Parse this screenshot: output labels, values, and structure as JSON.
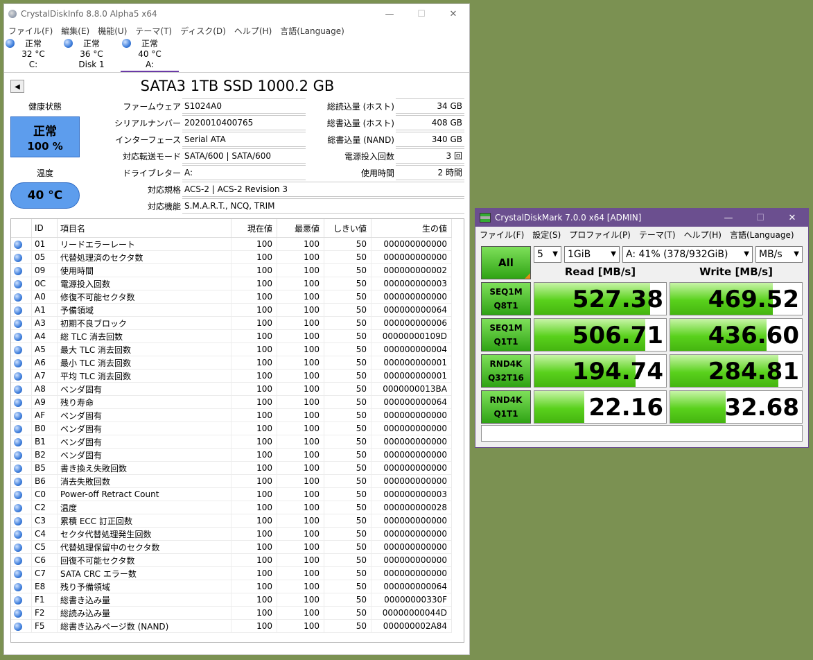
{
  "cdi": {
    "title": "CrystalDiskInfo 8.8.0 Alpha5 x64",
    "controls": [
      "—",
      "☐",
      "✕"
    ],
    "menu": [
      "ファイル(F)",
      "編集(E)",
      "機能(U)",
      "テーマ(T)",
      "ディスク(D)",
      "ヘルプ(H)",
      "言語(Language)"
    ],
    "tabs": [
      {
        "status": "正常",
        "temp": "32 °C",
        "name": "C:"
      },
      {
        "status": "正常",
        "temp": "36 °C",
        "name": "Disk 1"
      },
      {
        "status": "正常",
        "temp": "40 °C",
        "name": "A:"
      }
    ],
    "model": "SATA3 1TB SSD 1000.2 GB",
    "health_label": "健康状態",
    "health_status": "正常",
    "health_percent": "100 %",
    "temp_label": "温度",
    "temp_value": "40 °C",
    "left_fields": [
      {
        "label": "ファームウェア",
        "value": "S1024A0"
      },
      {
        "label": "シリアルナンバー",
        "value": "2020010400765"
      },
      {
        "label": "インターフェース",
        "value": "Serial ATA"
      },
      {
        "label": "対応転送モード",
        "value": "SATA/600 | SATA/600"
      },
      {
        "label": "ドライブレター",
        "value": "A:"
      }
    ],
    "right_fields": [
      {
        "label": "総読込量 (ホスト)",
        "value": "34 GB"
      },
      {
        "label": "総書込量 (ホスト)",
        "value": "408 GB"
      },
      {
        "label": "総書込量 (NAND)",
        "value": "340 GB"
      },
      {
        "label": "電源投入回数",
        "value": "3 回"
      },
      {
        "label": "使用時間",
        "value": "2 時間"
      }
    ],
    "wide_fields": [
      {
        "label": "対応規格",
        "value": "ACS-2 | ACS-2 Revision 3"
      },
      {
        "label": "対応機能",
        "value": "S.M.A.R.T., NCQ, TRIM"
      }
    ],
    "smart_headers": [
      "ID",
      "項目名",
      "現在値",
      "最悪値",
      "しきい値",
      "生の値"
    ],
    "smart_rows": [
      [
        "01",
        "リードエラーレート",
        "100",
        "100",
        "50",
        "000000000000"
      ],
      [
        "05",
        "代替処理済のセクタ数",
        "100",
        "100",
        "50",
        "000000000000"
      ],
      [
        "09",
        "使用時間",
        "100",
        "100",
        "50",
        "000000000002"
      ],
      [
        "0C",
        "電源投入回数",
        "100",
        "100",
        "50",
        "000000000003"
      ],
      [
        "A0",
        "修復不可能セクタ数",
        "100",
        "100",
        "50",
        "000000000000"
      ],
      [
        "A1",
        "予備領域",
        "100",
        "100",
        "50",
        "000000000064"
      ],
      [
        "A3",
        "初期不良ブロック",
        "100",
        "100",
        "50",
        "000000000006"
      ],
      [
        "A4",
        "総 TLC 消去回数",
        "100",
        "100",
        "50",
        "00000000109D"
      ],
      [
        "A5",
        "最大 TLC 消去回数",
        "100",
        "100",
        "50",
        "000000000004"
      ],
      [
        "A6",
        "最小 TLC 消去回数",
        "100",
        "100",
        "50",
        "000000000001"
      ],
      [
        "A7",
        "平均 TLC 消去回数",
        "100",
        "100",
        "50",
        "000000000001"
      ],
      [
        "A8",
        "ベンダ固有",
        "100",
        "100",
        "50",
        "0000000013BA"
      ],
      [
        "A9",
        "残り寿命",
        "100",
        "100",
        "50",
        "000000000064"
      ],
      [
        "AF",
        "ベンダ固有",
        "100",
        "100",
        "50",
        "000000000000"
      ],
      [
        "B0",
        "ベンダ固有",
        "100",
        "100",
        "50",
        "000000000000"
      ],
      [
        "B1",
        "ベンダ固有",
        "100",
        "100",
        "50",
        "000000000000"
      ],
      [
        "B2",
        "ベンダ固有",
        "100",
        "100",
        "50",
        "000000000000"
      ],
      [
        "B5",
        "書き換え失敗回数",
        "100",
        "100",
        "50",
        "000000000000"
      ],
      [
        "B6",
        "消去失敗回数",
        "100",
        "100",
        "50",
        "000000000000"
      ],
      [
        "C0",
        "Power-off Retract Count",
        "100",
        "100",
        "50",
        "000000000003"
      ],
      [
        "C2",
        "温度",
        "100",
        "100",
        "50",
        "000000000028"
      ],
      [
        "C3",
        "累積 ECC 訂正回数",
        "100",
        "100",
        "50",
        "000000000000"
      ],
      [
        "C4",
        "セクタ代替処理発生回数",
        "100",
        "100",
        "50",
        "000000000000"
      ],
      [
        "C5",
        "代替処理保留中のセクタ数",
        "100",
        "100",
        "50",
        "000000000000"
      ],
      [
        "C6",
        "回復不可能セクタ数",
        "100",
        "100",
        "50",
        "000000000000"
      ],
      [
        "C7",
        "SATA CRC エラー数",
        "100",
        "100",
        "50",
        "000000000000"
      ],
      [
        "E8",
        "残り予備領域",
        "100",
        "100",
        "50",
        "000000000064"
      ],
      [
        "F1",
        "総書き込み量",
        "100",
        "100",
        "50",
        "00000000330F"
      ],
      [
        "F2",
        "総読み込み量",
        "100",
        "100",
        "50",
        "00000000044D"
      ],
      [
        "F5",
        "総書き込みページ数 (NAND)",
        "100",
        "100",
        "50",
        "000000002A84"
      ]
    ]
  },
  "cdm": {
    "title": "CrystalDiskMark 7.0.0 x64 [ADMIN]",
    "controls": [
      "—",
      "☐",
      "✕"
    ],
    "menu": [
      "ファイル(F)",
      "設定(S)",
      "プロファイル(P)",
      "テーマ(T)",
      "ヘルプ(H)",
      "言語(Language)"
    ],
    "all_label": "All",
    "count": "5",
    "size": "1GiB",
    "drive": "A: 41% (378/932GiB)",
    "unit": "MB/s",
    "read_header": "Read [MB/s]",
    "write_header": "Write [MB/s]",
    "tests": [
      {
        "line1": "SEQ1M",
        "line2": "Q8T1",
        "read": "527.38",
        "write": "469.52",
        "read_level": 0.88,
        "write_level": 0.78
      },
      {
        "line1": "SEQ1M",
        "line2": "Q1T1",
        "read": "506.71",
        "write": "436.60",
        "read_level": 0.84,
        "write_level": 0.73
      },
      {
        "line1": "RND4K",
        "line2": "Q32T16",
        "read": "194.74",
        "write": "284.81",
        "read_level": 0.77,
        "write_level": 0.82
      },
      {
        "line1": "RND4K",
        "line2": "Q1T1",
        "read": "22.16",
        "write": "32.68",
        "read_level": 0.38,
        "write_level": 0.42
      }
    ]
  }
}
